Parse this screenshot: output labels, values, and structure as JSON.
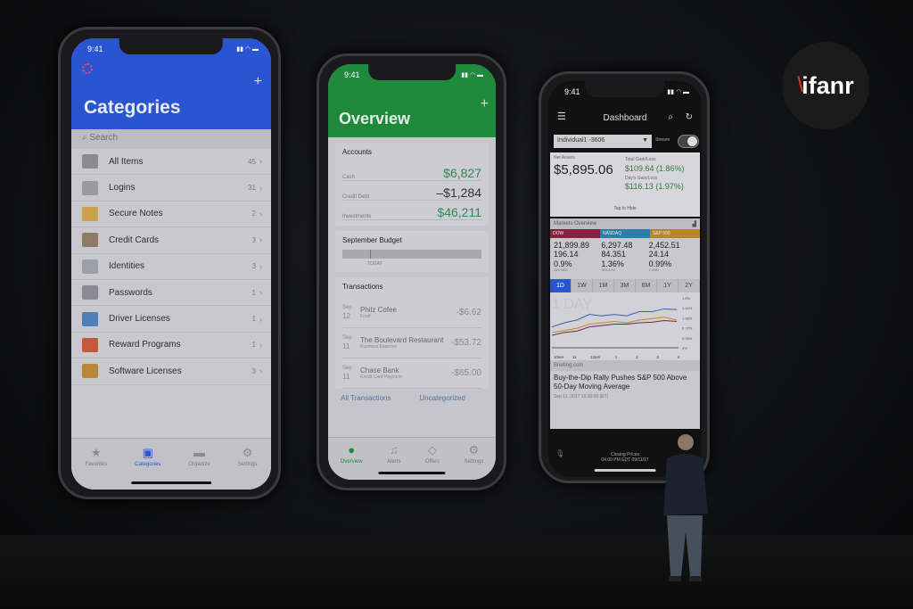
{
  "logo": "ifanr",
  "status_time": "9:41",
  "phone1": {
    "title": "Categories",
    "search_placeholder": "Search",
    "items": [
      {
        "label": "All Items",
        "count": "45",
        "icon": "grid-icon",
        "color": "#8a8a90"
      },
      {
        "label": "Logins",
        "count": "31",
        "icon": "key-icon",
        "color": "#9a9aa0"
      },
      {
        "label": "Secure Notes",
        "count": "2",
        "icon": "notepad-icon",
        "color": "#c9a24a"
      },
      {
        "label": "Credit Cards",
        "count": "3",
        "icon": "credit-card-icon",
        "color": "#8f7a64"
      },
      {
        "label": "Identities",
        "count": "3",
        "icon": "id-card-icon",
        "color": "#9aa0a8"
      },
      {
        "label": "Passwords",
        "count": "1",
        "icon": "password-key-icon",
        "color": "#8a8a96"
      },
      {
        "label": "Driver Licenses",
        "count": "1",
        "icon": "license-icon",
        "color": "#4f7fb8"
      },
      {
        "label": "Reward Programs",
        "count": "1",
        "icon": "reward-icon",
        "color": "#c25a3a"
      },
      {
        "label": "Software Licenses",
        "count": "3",
        "icon": "app-store-icon",
        "color": "#b9873a"
      }
    ],
    "tabs": [
      {
        "label": "Favorites",
        "icon": "★"
      },
      {
        "label": "Categories",
        "icon": "▣"
      },
      {
        "label": "Organize",
        "icon": "▬"
      },
      {
        "label": "Settings",
        "icon": "⚙"
      }
    ],
    "accent": "#2a55d2"
  },
  "phone2": {
    "title": "Overview",
    "accounts_title": "Accounts",
    "accounts": [
      {
        "label": "Cash",
        "value": "$6,827"
      },
      {
        "label": "Credit Debt",
        "value": "–$1,284"
      },
      {
        "label": "Investments",
        "value": "$46,211"
      }
    ],
    "budget_title": "September Budget",
    "budget_marker": "TODAY",
    "budget_progress": 0.2,
    "transactions_title": "Transactions",
    "transactions": [
      {
        "month": "Sep",
        "day": "12",
        "name": "Philz Cofee",
        "category": "Food",
        "amount": "-$6.62"
      },
      {
        "month": "Sep",
        "day": "11",
        "name": "The Boulevard Restaurant",
        "category": "Business Expense",
        "amount": "-$53.72"
      },
      {
        "month": "Sep",
        "day": "11",
        "name": "Chase Bank",
        "category": "Credit Card Payment",
        "amount": "-$65.00"
      }
    ],
    "links": [
      "All Transactions",
      "Uncategorized"
    ],
    "tabs": [
      {
        "label": "Overview",
        "icon": "●"
      },
      {
        "label": "Alerts",
        "icon": "♫"
      },
      {
        "label": "Offers",
        "icon": "◇"
      },
      {
        "label": "Settings",
        "icon": "⚙"
      }
    ],
    "accent": "#1f8a3c"
  },
  "phone3": {
    "title": "Dashboard",
    "account": "Individual1 -3606",
    "stream_label": "Stream",
    "net_assets_label": "Net Assets",
    "net_assets": "$5,895.06",
    "total_gain_label": "Total Gain/Loss",
    "total_gain": "$109.64 (1.86%)",
    "day_gain_label": "Day's Gain/Loss",
    "day_gain": "$116.13 (1.97%)",
    "tap_hide": "Tap to Hide",
    "markets_title": "Markets Overview",
    "indices": [
      {
        "name": "DOW",
        "value": "21,899.89",
        "change": "196.14",
        "pct": "0.9%",
        "volume": "244.98M",
        "color": "#8a1f3e"
      },
      {
        "name": "NASDAQ",
        "value": "6,297.48",
        "change": "84.351",
        "pct": "1.36%",
        "volume": "363.22M",
        "color": "#2a7fa6"
      },
      {
        "name": "S&P 500",
        "value": "2,452.51",
        "change": "24.14",
        "pct": "0.99%",
        "volume": "1.58M",
        "color": "#b7852a"
      }
    ],
    "ranges": [
      "1D",
      "1W",
      "1M",
      "3M",
      "6M",
      "1Y",
      "2Y"
    ],
    "selected_range": "1D",
    "chart_data": {
      "type": "line",
      "title": "1 DAY",
      "x_ticks": [
        "10am",
        "11",
        "12pm",
        "1",
        "2",
        "3",
        "4"
      ],
      "y_ticks": [
        "1.8%",
        "1.44%",
        "1.08%",
        "0.72%",
        "0.36%",
        "0%"
      ],
      "ylim": [
        0,
        1.8
      ],
      "series": [
        {
          "color": "#3a5ea8",
          "values": [
            0.75,
            0.9,
            1.0,
            1.2,
            1.15,
            1.2,
            1.15,
            1.3,
            1.3,
            1.4,
            1.38
          ]
        },
        {
          "color": "#c08a2a",
          "values": [
            0.55,
            0.62,
            0.7,
            0.85,
            0.9,
            0.95,
            0.9,
            1.0,
            1.05,
            1.1,
            1.0
          ]
        },
        {
          "color": "#6a2a4a",
          "values": [
            0.45,
            0.55,
            0.6,
            0.75,
            0.8,
            0.85,
            0.85,
            0.9,
            0.92,
            0.98,
            0.95
          ]
        }
      ]
    },
    "news_source": "Briefing.com",
    "news_headline": "Buy-the-Dip Rally Pushes S&P 500 Above 50-Day Moving Average",
    "news_date": "Sep 11, 2017 16:30:00 (ET)",
    "closing_label": "Closing Prices",
    "closing_time": "04:00 PM EDT 09/11/17"
  }
}
